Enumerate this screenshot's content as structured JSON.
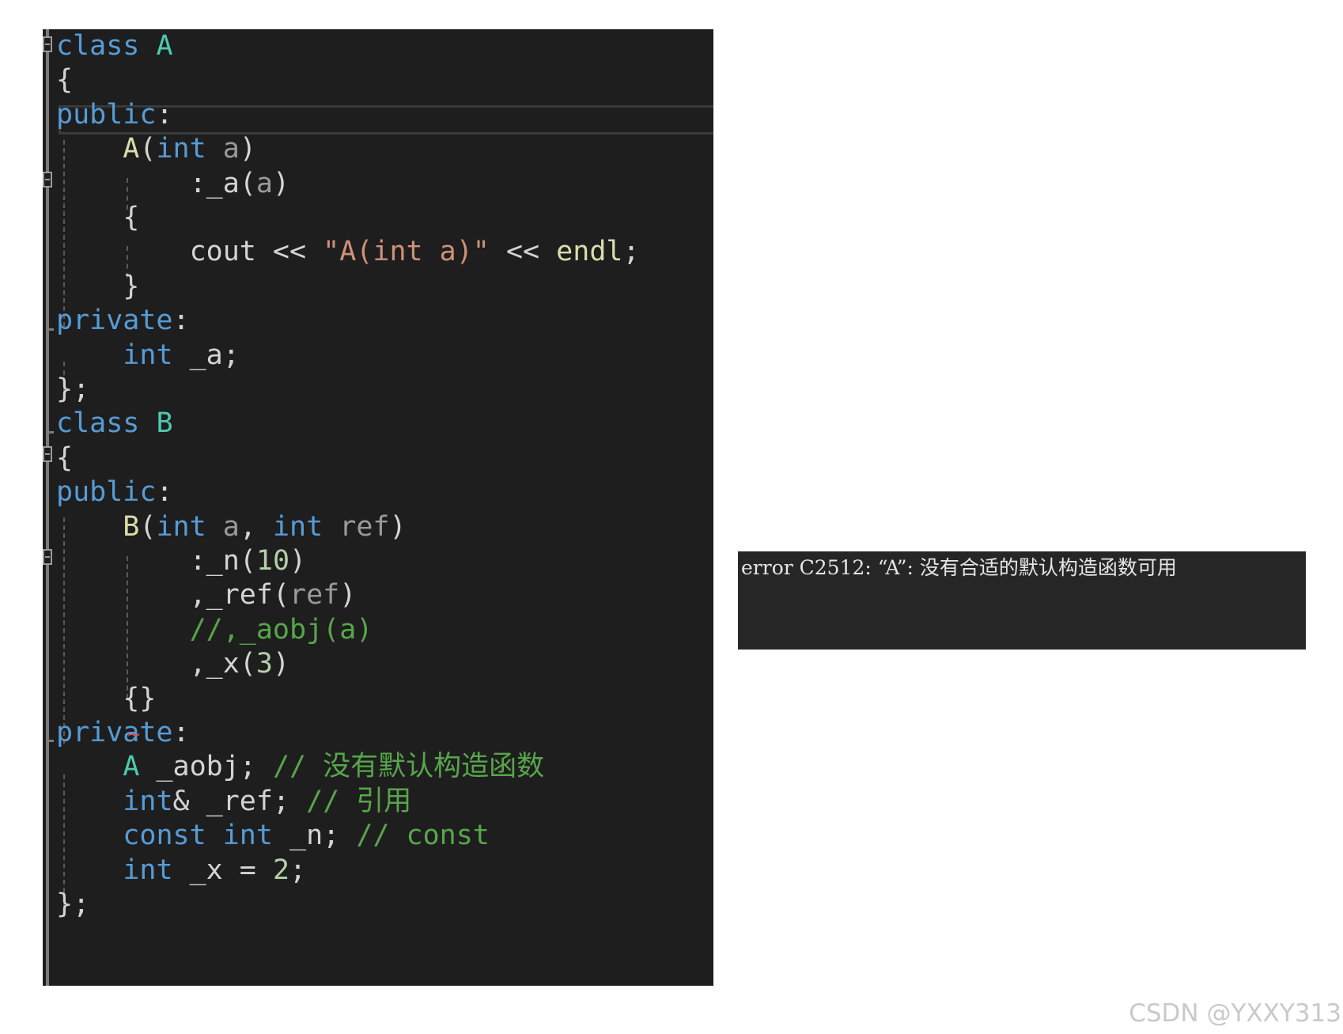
{
  "editor": {
    "lines": [
      [
        {
          "t": "class",
          "c": "kw"
        },
        {
          "t": " "
        },
        {
          "t": "A",
          "c": "ty"
        }
      ],
      [
        {
          "t": "{"
        }
      ],
      [
        {
          "t": "public",
          "c": "kw"
        },
        {
          "t": ":"
        }
      ],
      [
        {
          "t": "    "
        },
        {
          "t": "A",
          "c": "fn"
        },
        {
          "t": "("
        },
        {
          "t": "int",
          "c": "kw"
        },
        {
          "t": " "
        },
        {
          "t": "a",
          "c": "pa"
        },
        {
          "t": ")"
        }
      ],
      [
        {
          "t": "        :"
        },
        {
          "t": "_a"
        },
        {
          "t": "("
        },
        {
          "t": "a",
          "c": "pa"
        },
        {
          "t": ")"
        }
      ],
      [
        {
          "t": "    {"
        }
      ],
      [
        {
          "t": "        cout << "
        },
        {
          "t": "\"A(int a)\"",
          "c": "st"
        },
        {
          "t": " << "
        },
        {
          "t": "endl",
          "c": "fn"
        },
        {
          "t": ";"
        }
      ],
      [
        {
          "t": "    }"
        }
      ],
      [
        {
          "t": "private",
          "c": "kw"
        },
        {
          "t": ":"
        }
      ],
      [
        {
          "t": "    "
        },
        {
          "t": "int",
          "c": "kw"
        },
        {
          "t": " _a;"
        }
      ],
      [
        {
          "t": "};"
        }
      ],
      [
        {
          "t": "class",
          "c": "kw"
        },
        {
          "t": " "
        },
        {
          "t": "B",
          "c": "ty"
        }
      ],
      [
        {
          "t": "{"
        }
      ],
      [
        {
          "t": "public",
          "c": "kw"
        },
        {
          "t": ":"
        }
      ],
      [
        {
          "t": "    "
        },
        {
          "t": "B",
          "c": "fn"
        },
        {
          "t": "("
        },
        {
          "t": "int",
          "c": "kw"
        },
        {
          "t": " "
        },
        {
          "t": "a",
          "c": "pa"
        },
        {
          "t": ", "
        },
        {
          "t": "int",
          "c": "kw"
        },
        {
          "t": " "
        },
        {
          "t": "ref",
          "c": "pa"
        },
        {
          "t": ")"
        }
      ],
      [
        {
          "t": "        :"
        },
        {
          "t": "_n"
        },
        {
          "t": "("
        },
        {
          "t": "10",
          "c": "nu"
        },
        {
          "t": ")"
        }
      ],
      [
        {
          "t": "        ,"
        },
        {
          "t": "_ref"
        },
        {
          "t": "("
        },
        {
          "t": "ref",
          "c": "pa"
        },
        {
          "t": ")"
        }
      ],
      [
        {
          "t": "        "
        },
        {
          "t": "//,_aobj(a)",
          "c": "cm"
        }
      ],
      [
        {
          "t": "        ,"
        },
        {
          "t": "_x"
        },
        {
          "t": "("
        },
        {
          "t": "3",
          "c": "nu"
        },
        {
          "t": ")"
        }
      ],
      [
        {
          "t": "    {}"
        }
      ],
      [
        {
          "t": "private",
          "c": "kw"
        },
        {
          "t": ":"
        }
      ],
      [
        {
          "t": "    "
        },
        {
          "t": "A",
          "c": "ty"
        },
        {
          "t": " _aobj; "
        },
        {
          "t": "// 没有默认构造函数",
          "c": "cm"
        }
      ],
      [
        {
          "t": "    "
        },
        {
          "t": "int",
          "c": "kw"
        },
        {
          "t": "& _ref; "
        },
        {
          "t": "// 引用",
          "c": "cm"
        }
      ],
      [
        {
          "t": "    "
        },
        {
          "t": "const",
          "c": "kw"
        },
        {
          "t": " "
        },
        {
          "t": "int",
          "c": "kw"
        },
        {
          "t": " _n; "
        },
        {
          "t": "// const",
          "c": "cm"
        }
      ],
      [
        {
          "t": "    "
        },
        {
          "t": "int",
          "c": "kw"
        },
        {
          "t": " _x = "
        },
        {
          "t": "2",
          "c": "nu"
        },
        {
          "t": ";"
        }
      ],
      [
        {
          "t": "};"
        }
      ]
    ],
    "error_squiggle": "~"
  },
  "error_panel": {
    "message": "error C2512: “A”: 没有合适的默认构造函数可用"
  },
  "watermark": "CSDN @YXXY313"
}
